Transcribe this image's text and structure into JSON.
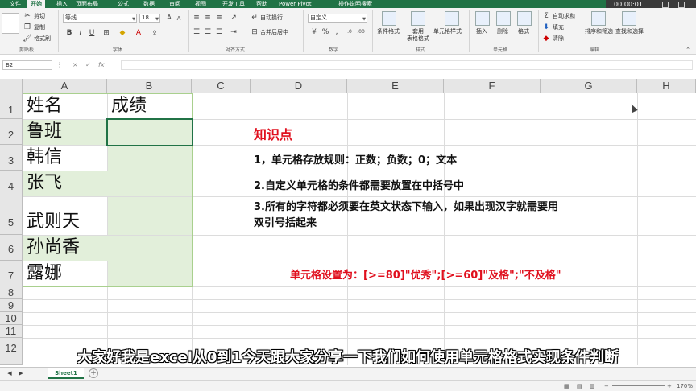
{
  "ribbon_tabs": [
    {
      "label": "文件",
      "active": false
    },
    {
      "label": "开始",
      "active": true
    },
    {
      "label": "插入",
      "active": false
    },
    {
      "label": "页面布局",
      "active": false
    },
    {
      "label": "公式",
      "active": false
    },
    {
      "label": "数据",
      "active": false
    },
    {
      "label": "审阅",
      "active": false
    },
    {
      "label": "视图",
      "active": false
    },
    {
      "label": "开发工具",
      "active": false
    },
    {
      "label": "帮助",
      "active": false
    },
    {
      "label": "Power Pivot",
      "active": false
    },
    {
      "label": "操作说明搜索",
      "active": false
    }
  ],
  "video": {
    "timer": "00:00:01"
  },
  "clipboard": {
    "cut": "剪切",
    "copy": "复制",
    "format_painter": "格式刷",
    "label": "剪贴板"
  },
  "font": {
    "name": "等线",
    "size": "18",
    "label": "字体"
  },
  "alignment": {
    "wrap": "自动换行",
    "merge": "合并后居中",
    "label": "对齐方式"
  },
  "number": {
    "format": "自定义",
    "label": "数字"
  },
  "styles": {
    "conditional": "条件格式",
    "table_format": "套用\n表格格式",
    "cell_styles": "单元格样式",
    "label": "样式"
  },
  "cells": {
    "insert": "插入",
    "delete": "删除",
    "format": "格式",
    "label": "单元格"
  },
  "editing": {
    "autosum": "自动求和",
    "fill": "填充",
    "clear": "清除",
    "sort": "排序和筛选",
    "find": "查找和选择",
    "label": "编辑"
  },
  "formula_bar": {
    "name_box": "B2",
    "cancel": "×",
    "enter": "✓",
    "fx": "fx"
  },
  "columns": [
    "A",
    "B",
    "C",
    "D",
    "E",
    "F",
    "G",
    "H"
  ],
  "rows": [
    "1",
    "2",
    "3",
    "4",
    "5",
    "6",
    "7",
    "8",
    "9",
    "10",
    "11",
    "12"
  ],
  "cells_data": {
    "A1": "姓名",
    "B1": "成绩",
    "A2": "鲁班",
    "A3": "韩信",
    "A4": "张飞",
    "A5": "武则天",
    "A6": "孙尚香",
    "A7": "露娜"
  },
  "notes": {
    "title": "知识点",
    "line1": "1，单元格存放规则：正数；负数；0；文本",
    "line2": "2.自定义单元格的条件都需要放置在中括号中",
    "line3a": "3.所有的字符都必须要在英文状态下输入，如果出现汉字就需要用",
    "line3b": "双引号括起来",
    "setting": "单元格设置为：[>=80]\"优秀\";[>=60]\"及格\";\"不及格\""
  },
  "subtitle": "大家好我是excel从0到1今天跟大家分享一下我们如何使用单元格格式实现条件判断",
  "sheet_tabs": [
    "Sheet1"
  ],
  "status": {
    "zoom": "170%"
  },
  "colors": {
    "accent": "#217346",
    "highlight": "#e2efda",
    "note_red": "#e0101e"
  }
}
